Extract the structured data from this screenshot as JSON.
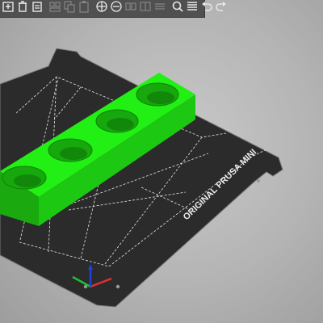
{
  "bed_label": "ORIGINAL PRUSA MINI",
  "colors": {
    "toolbar_bg": "#505050",
    "icon": "#e8e8e8",
    "bed": "#2b2b2b",
    "bed_edge": "#7a7a7a",
    "grid": "#e6e6e6",
    "model_top": "#22f014",
    "model_side": "#1bbf0f",
    "axis_x": "#e03030",
    "axis_y": "#20c030",
    "axis_z": "#2040e0"
  },
  "toolbar": {
    "buttons": [
      {
        "icon": "add-icon"
      },
      {
        "icon": "delete-icon"
      },
      {
        "icon": "delete-all-icon"
      },
      {
        "icon": "arrange-icon"
      },
      {
        "icon": "copy-icon"
      },
      {
        "icon": "paste-icon"
      },
      {
        "icon": "add-instance-icon"
      },
      {
        "icon": "remove-instance-icon"
      },
      {
        "icon": "split-objects-icon"
      },
      {
        "icon": "split-parts-icon"
      },
      {
        "icon": "layers-editing-icon"
      },
      {
        "icon": "search-icon"
      },
      {
        "icon": "menu-icon"
      },
      {
        "icon": "undo-icon"
      },
      {
        "icon": "redo-icon"
      }
    ]
  }
}
